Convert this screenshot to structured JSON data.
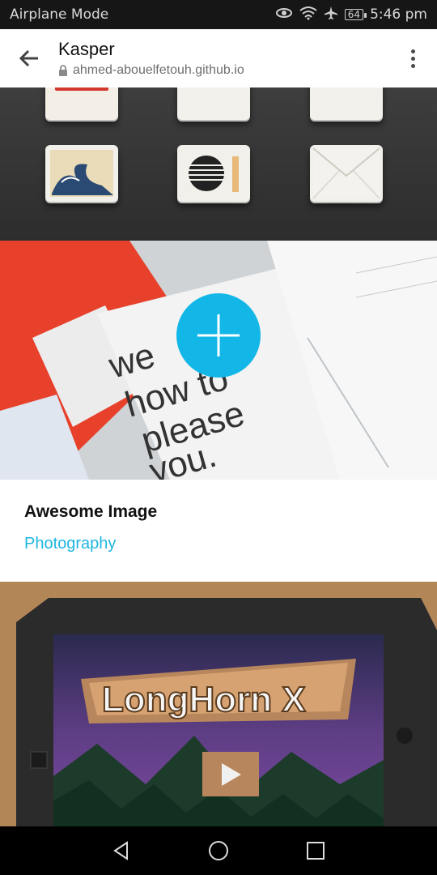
{
  "status_bar": {
    "left_text": "Airplane Mode",
    "time": "5:46 pm",
    "battery": "64",
    "icons": [
      "eye-icon",
      "wifi-icon",
      "airplane-icon",
      "battery-icon"
    ]
  },
  "app_bar": {
    "title": "Kasper",
    "url": "ahmed-abouelfetouh.github.io"
  },
  "portfolio": {
    "card": {
      "title": "Awesome Image",
      "category": "Photography"
    },
    "game_logo": "LongHorn X",
    "photo_text": [
      "we",
      "how to",
      "please",
      "you."
    ]
  },
  "colors": {
    "accent": "#12b7e8",
    "category": "#1fb6e0"
  }
}
